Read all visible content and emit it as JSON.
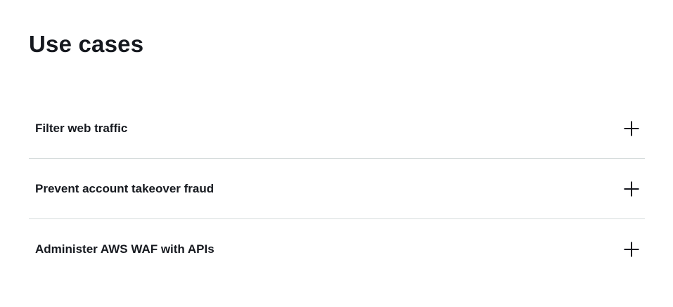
{
  "section": {
    "title": "Use cases"
  },
  "accordion": {
    "items": [
      {
        "label": "Filter web traffic",
        "icon": "plus-icon",
        "expanded": false
      },
      {
        "label": "Prevent account takeover fraud",
        "icon": "plus-icon",
        "expanded": false
      },
      {
        "label": "Administer AWS WAF with APIs",
        "icon": "plus-icon",
        "expanded": false
      }
    ]
  }
}
